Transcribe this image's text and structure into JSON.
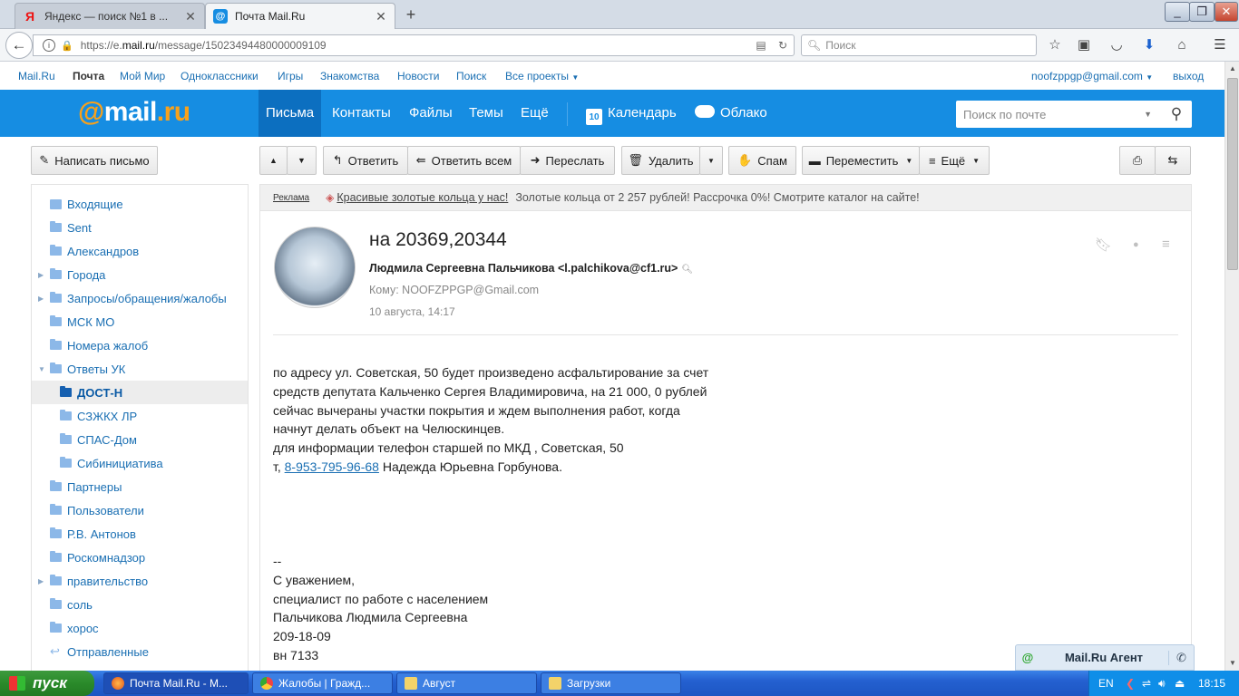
{
  "browser": {
    "tabs": [
      {
        "title": "Яндекс — поиск №1 в ...",
        "icon": "yandex-icon"
      },
      {
        "title": "Почта Mail.Ru",
        "icon": "mailru-icon"
      }
    ],
    "url_prefix": "https://e.",
    "url_domain": "mail.ru",
    "url_path": "/message/15023494480000009109",
    "search_placeholder": "Поиск"
  },
  "portal": {
    "links": [
      "Mail.Ru",
      "Почта",
      "Мой Мир",
      "Одноклассники",
      "Игры",
      "Знакомства",
      "Новости",
      "Поиск",
      "Все проекты"
    ],
    "user": "noofzppgp@gmail.com",
    "logout": "выход"
  },
  "header": {
    "logo_at": "@",
    "logo_mail": "mail",
    "logo_ru": ".ru",
    "nav": [
      "Письма",
      "Контакты",
      "Файлы",
      "Темы",
      "Ещё"
    ],
    "calendar_day": "10",
    "calendar": "Календарь",
    "cloud": "Облако",
    "search_placeholder": "Поиск по почте"
  },
  "toolbar": {
    "compose": "Написать письмо",
    "reply": "Ответить",
    "reply_all": "Ответить всем",
    "forward": "Переслать",
    "delete": "Удалить",
    "spam": "Спам",
    "move": "Переместить",
    "more": "Ещё"
  },
  "folders": [
    {
      "label": "Входящие",
      "level": 0,
      "arrow": ""
    },
    {
      "label": "Sent",
      "level": 0,
      "arrow": ""
    },
    {
      "label": "Александров",
      "level": 0,
      "arrow": ""
    },
    {
      "label": "Города",
      "level": 0,
      "arrow": "▶"
    },
    {
      "label": "Запросы/обращения/жалобы",
      "level": 0,
      "arrow": "▶"
    },
    {
      "label": "МСК МО",
      "level": 0,
      "arrow": ""
    },
    {
      "label": "Номера жалоб",
      "level": 0,
      "arrow": ""
    },
    {
      "label": "Ответы УК",
      "level": 0,
      "arrow": "▼"
    },
    {
      "label": "ДОСТ-Н",
      "level": 1,
      "arrow": ""
    },
    {
      "label": "СЗЖКХ ЛР",
      "level": 1,
      "arrow": ""
    },
    {
      "label": "СПАС-Дом",
      "level": 1,
      "arrow": ""
    },
    {
      "label": "Сибинициатива",
      "level": 1,
      "arrow": ""
    },
    {
      "label": "Партнеры",
      "level": 0,
      "arrow": ""
    },
    {
      "label": "Пользователи",
      "level": 0,
      "arrow": ""
    },
    {
      "label": "Р.В. Антонов",
      "level": 0,
      "arrow": ""
    },
    {
      "label": "Роскомнадзор",
      "level": 0,
      "arrow": ""
    },
    {
      "label": "правительство",
      "level": 0,
      "arrow": "▶"
    },
    {
      "label": "соль",
      "level": 0,
      "arrow": ""
    },
    {
      "label": "хорос",
      "level": 0,
      "arrow": ""
    },
    {
      "label": "Отправленные",
      "level": 0,
      "arrow": ""
    }
  ],
  "selected_folder": "ДОСТ-Н",
  "ad": {
    "label": "Реклама",
    "link": "Красивые золотые кольца у нас!",
    "text": "Золотые кольца от 2 257 рублей! Рассрочка 0%! Смотрите каталог на сайте!"
  },
  "message": {
    "subject": "на 20369,20344",
    "from": "Людмила Сергеевна Пальчикова <l.palchikova@cf1.ru>",
    "to": "Кому: NOOFZPPGP@Gmail.com",
    "date": "10 августа, 14:17",
    "body": [
      "по адресу ул. Советская, 50 будет произведено асфальтирование за счет",
      "средств депутата Кальченко Сергея Владимировича, на 21 000, 0 рублей",
      "сейчас вычераны участки покрытия и ждем выполнения работ, когда",
      "начнут делать объект на Челюскинцев.",
      "для информации телефон старшей по МКД , Советская, 50",
      "",
      "",
      "",
      "",
      "",
      "--",
      "С уважением,",
      "специалист по работе с населением",
      "Пальчикова Людмила Сергеевна",
      "209-18-09",
      "вн 7133"
    ],
    "phone_prefix": "т, ",
    "phone": "8-953-795-96-68",
    "phone_suffix": " Надежда Юрьевна Горбунова."
  },
  "agent": {
    "title": "Mail.Ru Агент"
  },
  "taskbar": {
    "start": "пуск",
    "items": [
      "Почта Mail.Ru - M...",
      "Жалобы | Гражд...",
      "Август",
      "Загрузки"
    ],
    "lang": "EN",
    "time": "18:15"
  },
  "colors": {
    "header": "#168de2",
    "link": "#1a6fb3",
    "logo_accent": "#f8a11b"
  }
}
